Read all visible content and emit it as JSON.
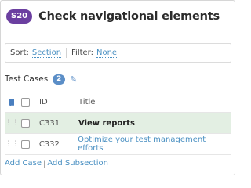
{
  "header": {
    "badge": "S20",
    "title": "Check navigational elements"
  },
  "filters": {
    "sort_label": "Sort:",
    "sort_value": "Section",
    "filter_label": "Filter:",
    "filter_value": "None"
  },
  "section": {
    "label": "Test Cases",
    "count": "2"
  },
  "table": {
    "columns": {
      "id": "ID",
      "title": "Title"
    },
    "rows": [
      {
        "id": "C331",
        "title": "View reports",
        "selected": true
      },
      {
        "id": "C332",
        "title": "Optimize your test management efforts",
        "selected": false
      }
    ]
  },
  "footer": {
    "add_case": "Add Case",
    "separator": "|",
    "add_subsection": "Add Subsection"
  },
  "colors": {
    "badge": "#6b3fa0",
    "accent": "#4a90c2",
    "selected_row": "#e3efe3"
  }
}
